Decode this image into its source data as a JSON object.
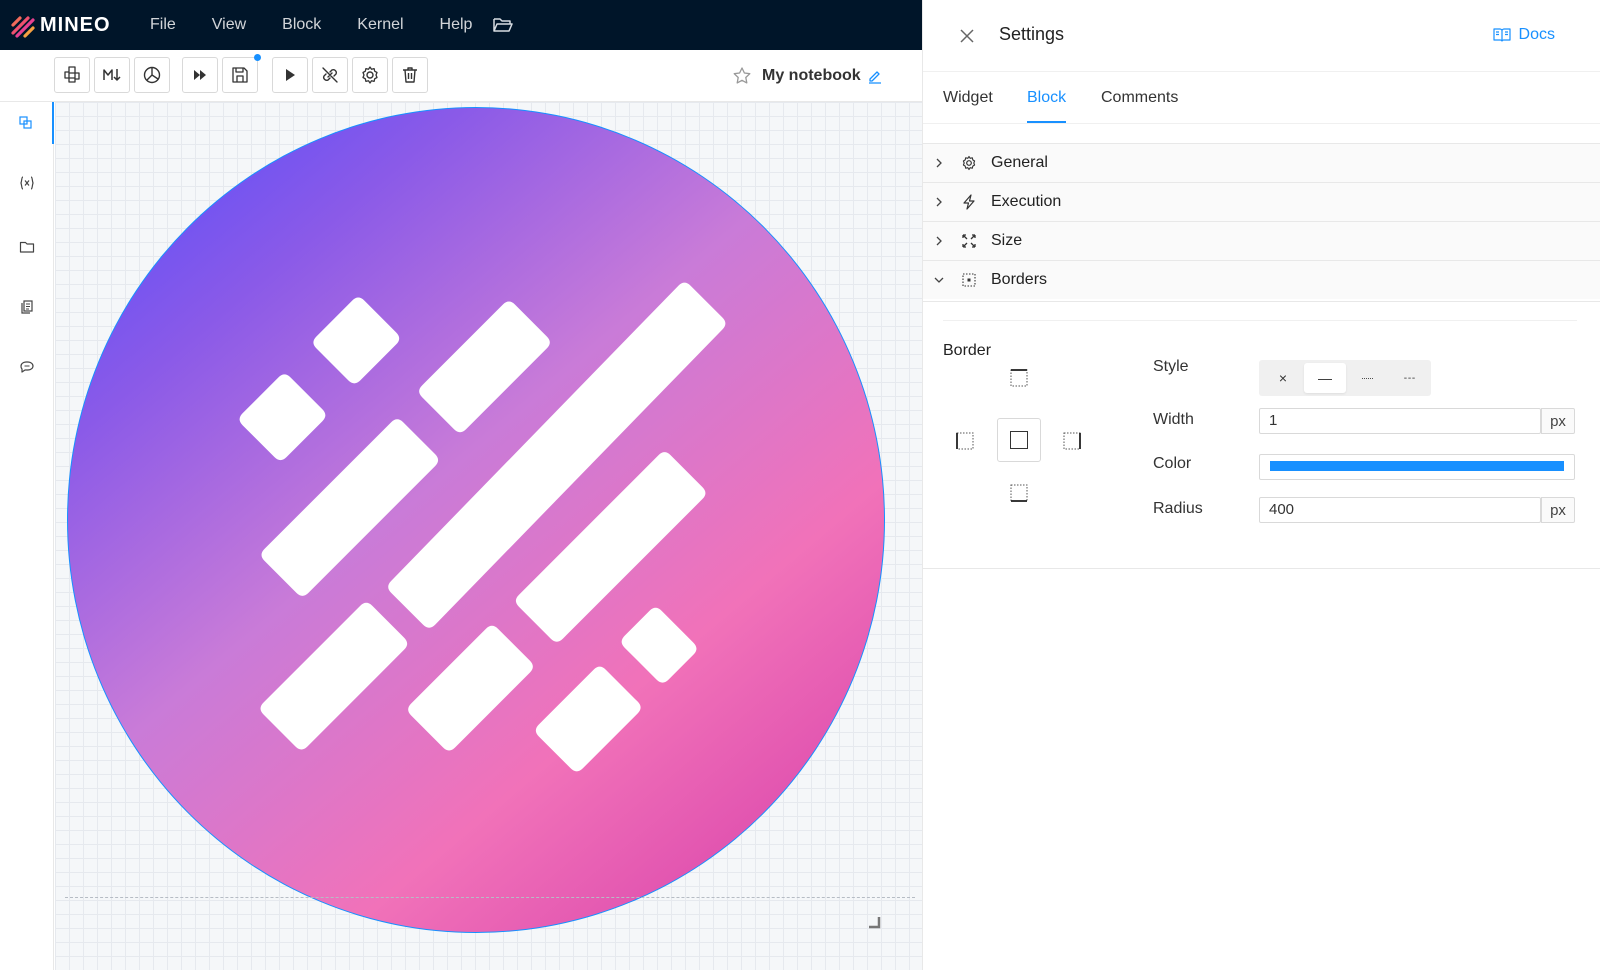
{
  "app": {
    "logo_text": "MINEO"
  },
  "menu": {
    "items": [
      "File",
      "View",
      "Block",
      "Kernel",
      "Help"
    ]
  },
  "notebook": {
    "title": "My notebook"
  },
  "settings": {
    "title": "Settings",
    "docs_label": "Docs",
    "tabs": [
      "Widget",
      "Block",
      "Comments"
    ],
    "active_tab": "Block",
    "panels": [
      "General",
      "Execution",
      "Size",
      "Borders"
    ],
    "border": {
      "section_label": "Border",
      "style_label": "Style",
      "width_label": "Width",
      "width_value": "1",
      "width_unit": "px",
      "color_label": "Color",
      "color_value": "#1890ff",
      "radius_label": "Radius",
      "radius_value": "400",
      "radius_unit": "px",
      "style_options": [
        "×",
        "—",
        "······",
        "- - -"
      ],
      "selected_style": "solid"
    }
  },
  "colors": {
    "accent": "#1890ff",
    "topbar": "#001529",
    "gradient_start": "#4f4bff",
    "gradient_end": "#d43aa8"
  }
}
